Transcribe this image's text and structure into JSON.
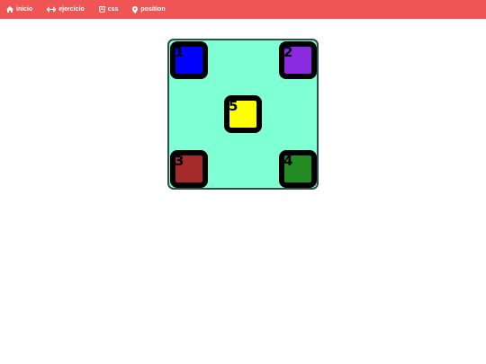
{
  "nav": {
    "items": [
      {
        "label": "inicio",
        "icon": "home-icon"
      },
      {
        "label": "ejercicio",
        "icon": "dumbbell-icon"
      },
      {
        "label": "css",
        "icon": "css3-icon"
      },
      {
        "label": "position",
        "icon": "map-pin-icon"
      }
    ],
    "background": "#f05556",
    "text_color": "#ffffff"
  },
  "stage": {
    "background": "#7fffd4",
    "border_color": "#2f4f4f",
    "boxes": [
      {
        "label": "1",
        "color": "#0000ff"
      },
      {
        "label": "2",
        "color": "#8a2be2"
      },
      {
        "label": "3",
        "color": "#a52a2a"
      },
      {
        "label": "4",
        "color": "#228b22"
      },
      {
        "label": "5",
        "color": "#ffff00"
      }
    ]
  }
}
